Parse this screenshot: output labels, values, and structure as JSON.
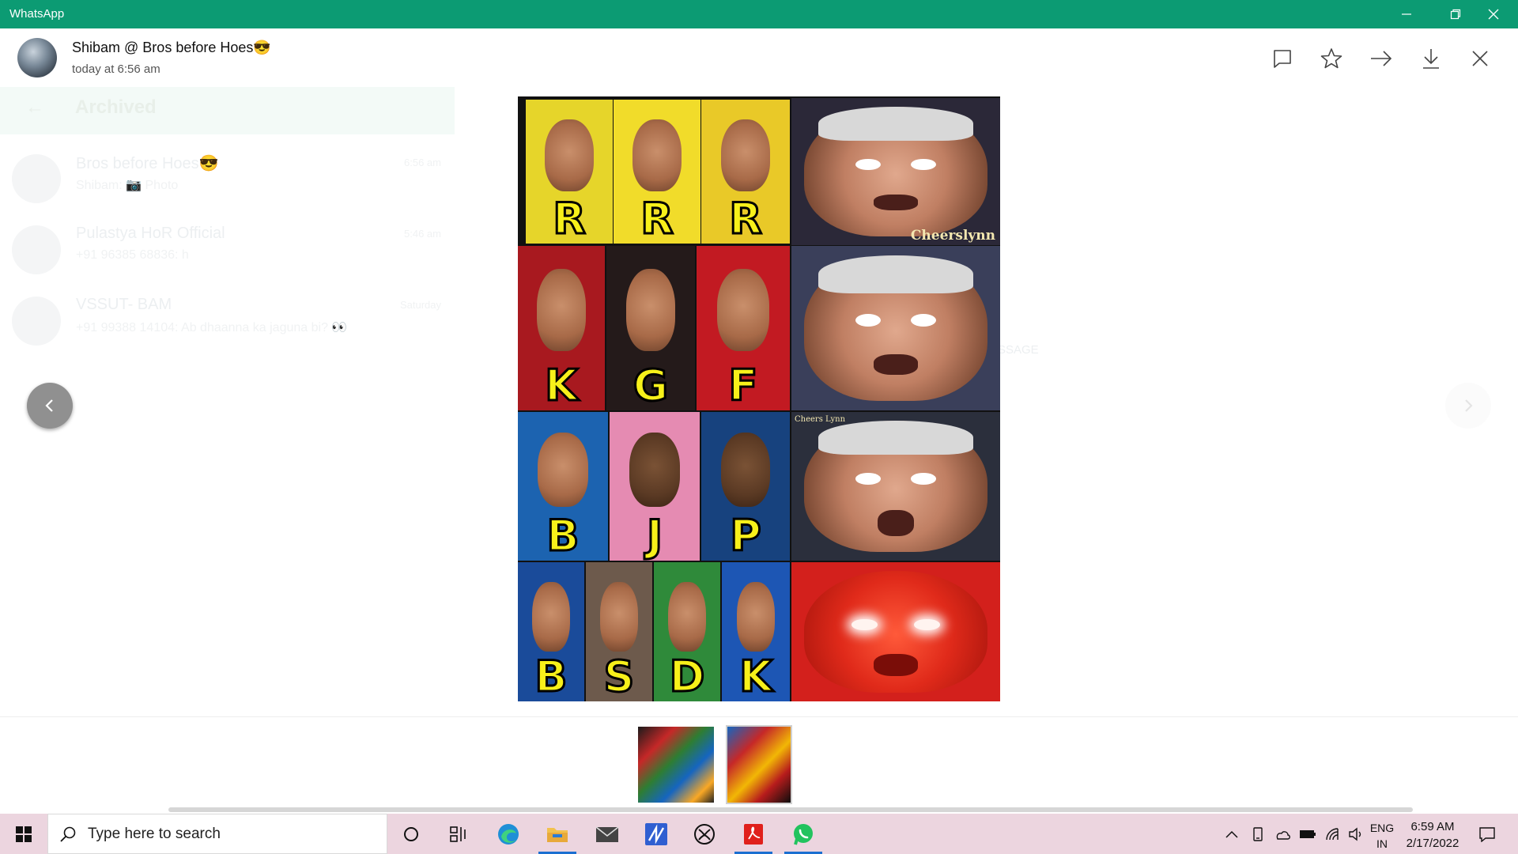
{
  "app": {
    "title": "WhatsApp"
  },
  "viewer": {
    "sender": "Shibam @ Bros before Hoes😎",
    "time": "today at 6:56 am",
    "actions": [
      "reply-icon",
      "star-icon",
      "forward-icon",
      "download-icon",
      "close-icon"
    ]
  },
  "background": {
    "header": "Archived",
    "chats": [
      {
        "name": "Bros before Hoes😎",
        "preview": "Shibam: 📷 Photo",
        "time": "6:56 am"
      },
      {
        "name": "Pulastya HoR Official",
        "preview": "+91 96385 68836: h",
        "time": "5:46 am"
      },
      {
        "name": "VSSUT- BAM",
        "preview": "+91 99388 14104: Ab dhaanna ka jaguna bi? 👀",
        "time": "Saturday"
      }
    ],
    "ghost_text": "SSAGE"
  },
  "meme": {
    "watermark": "Cheerslynn",
    "watermark_small": "Cheers Lynn",
    "rows": [
      [
        "R",
        "R",
        "R"
      ],
      [
        "K",
        "G",
        "F"
      ],
      [
        "B",
        "J",
        "P"
      ],
      [
        "B",
        "S",
        "D",
        "K"
      ]
    ]
  },
  "taskbar": {
    "search_placeholder": "Type here to search",
    "lang_1": "ENG",
    "lang_2": "IN",
    "time": "6:59 AM",
    "date": "2/17/2022"
  },
  "colors": {
    "titlebar": "#0c9b73",
    "taskbar": "#ecd5df",
    "letter": "#f7f01a"
  }
}
